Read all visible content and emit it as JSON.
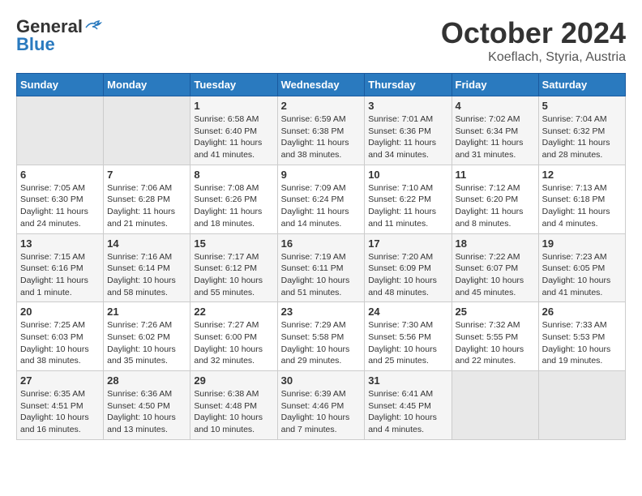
{
  "header": {
    "logo_general": "General",
    "logo_blue": "Blue",
    "title": "October 2024",
    "subtitle": "Koeflach, Styria, Austria"
  },
  "weekdays": [
    "Sunday",
    "Monday",
    "Tuesday",
    "Wednesday",
    "Thursday",
    "Friday",
    "Saturday"
  ],
  "weeks": [
    [
      {
        "day": "",
        "info": ""
      },
      {
        "day": "",
        "info": ""
      },
      {
        "day": "1",
        "info": "Sunrise: 6:58 AM\nSunset: 6:40 PM\nDaylight: 11 hours and 41 minutes."
      },
      {
        "day": "2",
        "info": "Sunrise: 6:59 AM\nSunset: 6:38 PM\nDaylight: 11 hours and 38 minutes."
      },
      {
        "day": "3",
        "info": "Sunrise: 7:01 AM\nSunset: 6:36 PM\nDaylight: 11 hours and 34 minutes."
      },
      {
        "day": "4",
        "info": "Sunrise: 7:02 AM\nSunset: 6:34 PM\nDaylight: 11 hours and 31 minutes."
      },
      {
        "day": "5",
        "info": "Sunrise: 7:04 AM\nSunset: 6:32 PM\nDaylight: 11 hours and 28 minutes."
      }
    ],
    [
      {
        "day": "6",
        "info": "Sunrise: 7:05 AM\nSunset: 6:30 PM\nDaylight: 11 hours and 24 minutes."
      },
      {
        "day": "7",
        "info": "Sunrise: 7:06 AM\nSunset: 6:28 PM\nDaylight: 11 hours and 21 minutes."
      },
      {
        "day": "8",
        "info": "Sunrise: 7:08 AM\nSunset: 6:26 PM\nDaylight: 11 hours and 18 minutes."
      },
      {
        "day": "9",
        "info": "Sunrise: 7:09 AM\nSunset: 6:24 PM\nDaylight: 11 hours and 14 minutes."
      },
      {
        "day": "10",
        "info": "Sunrise: 7:10 AM\nSunset: 6:22 PM\nDaylight: 11 hours and 11 minutes."
      },
      {
        "day": "11",
        "info": "Sunrise: 7:12 AM\nSunset: 6:20 PM\nDaylight: 11 hours and 8 minutes."
      },
      {
        "day": "12",
        "info": "Sunrise: 7:13 AM\nSunset: 6:18 PM\nDaylight: 11 hours and 4 minutes."
      }
    ],
    [
      {
        "day": "13",
        "info": "Sunrise: 7:15 AM\nSunset: 6:16 PM\nDaylight: 11 hours and 1 minute."
      },
      {
        "day": "14",
        "info": "Sunrise: 7:16 AM\nSunset: 6:14 PM\nDaylight: 10 hours and 58 minutes."
      },
      {
        "day": "15",
        "info": "Sunrise: 7:17 AM\nSunset: 6:12 PM\nDaylight: 10 hours and 55 minutes."
      },
      {
        "day": "16",
        "info": "Sunrise: 7:19 AM\nSunset: 6:11 PM\nDaylight: 10 hours and 51 minutes."
      },
      {
        "day": "17",
        "info": "Sunrise: 7:20 AM\nSunset: 6:09 PM\nDaylight: 10 hours and 48 minutes."
      },
      {
        "day": "18",
        "info": "Sunrise: 7:22 AM\nSunset: 6:07 PM\nDaylight: 10 hours and 45 minutes."
      },
      {
        "day": "19",
        "info": "Sunrise: 7:23 AM\nSunset: 6:05 PM\nDaylight: 10 hours and 41 minutes."
      }
    ],
    [
      {
        "day": "20",
        "info": "Sunrise: 7:25 AM\nSunset: 6:03 PM\nDaylight: 10 hours and 38 minutes."
      },
      {
        "day": "21",
        "info": "Sunrise: 7:26 AM\nSunset: 6:02 PM\nDaylight: 10 hours and 35 minutes."
      },
      {
        "day": "22",
        "info": "Sunrise: 7:27 AM\nSunset: 6:00 PM\nDaylight: 10 hours and 32 minutes."
      },
      {
        "day": "23",
        "info": "Sunrise: 7:29 AM\nSunset: 5:58 PM\nDaylight: 10 hours and 29 minutes."
      },
      {
        "day": "24",
        "info": "Sunrise: 7:30 AM\nSunset: 5:56 PM\nDaylight: 10 hours and 25 minutes."
      },
      {
        "day": "25",
        "info": "Sunrise: 7:32 AM\nSunset: 5:55 PM\nDaylight: 10 hours and 22 minutes."
      },
      {
        "day": "26",
        "info": "Sunrise: 7:33 AM\nSunset: 5:53 PM\nDaylight: 10 hours and 19 minutes."
      }
    ],
    [
      {
        "day": "27",
        "info": "Sunrise: 6:35 AM\nSunset: 4:51 PM\nDaylight: 10 hours and 16 minutes."
      },
      {
        "day": "28",
        "info": "Sunrise: 6:36 AM\nSunset: 4:50 PM\nDaylight: 10 hours and 13 minutes."
      },
      {
        "day": "29",
        "info": "Sunrise: 6:38 AM\nSunset: 4:48 PM\nDaylight: 10 hours and 10 minutes."
      },
      {
        "day": "30",
        "info": "Sunrise: 6:39 AM\nSunset: 4:46 PM\nDaylight: 10 hours and 7 minutes."
      },
      {
        "day": "31",
        "info": "Sunrise: 6:41 AM\nSunset: 4:45 PM\nDaylight: 10 hours and 4 minutes."
      },
      {
        "day": "",
        "info": ""
      },
      {
        "day": "",
        "info": ""
      }
    ]
  ]
}
